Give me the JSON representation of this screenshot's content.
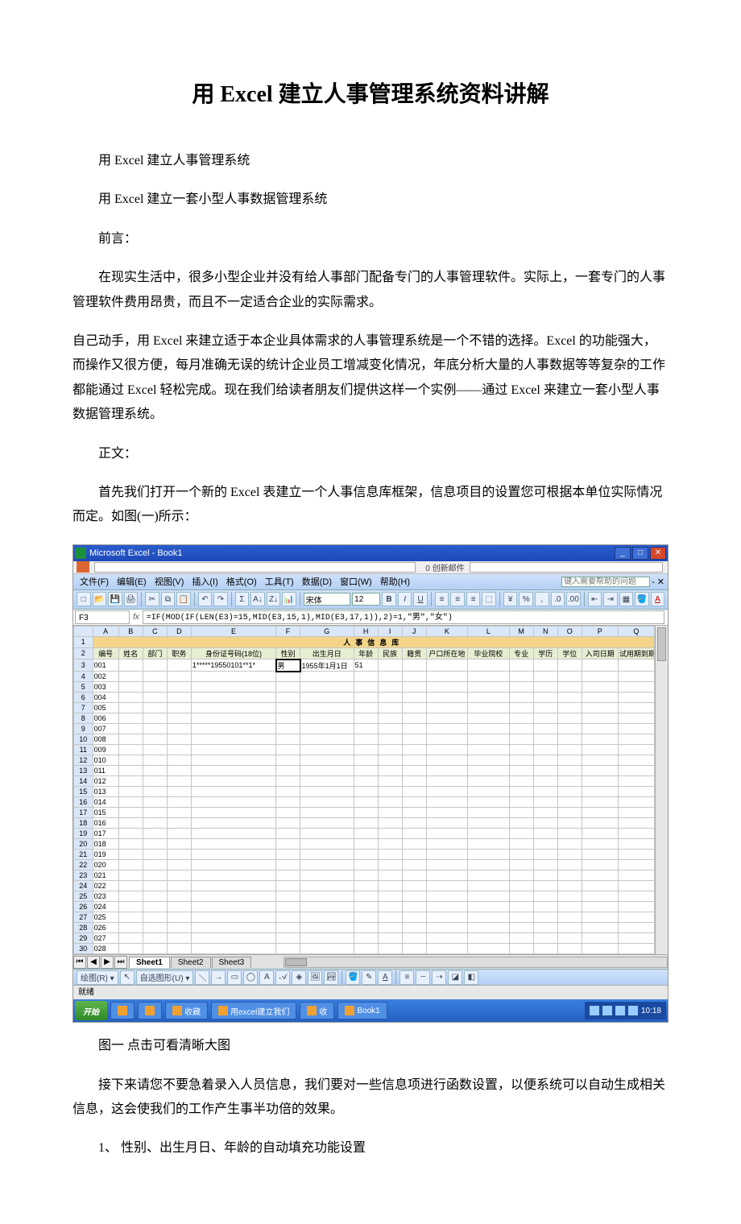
{
  "doc": {
    "title": "用 Excel 建立人事管理系统资料讲解",
    "p1": "用 Excel 建立人事管理系统",
    "p2": "用 Excel 建立一套小型人事数据管理系统",
    "p3": "前言：",
    "p4": "在现实生活中，很多小型企业并没有给人事部门配备专门的人事管理软件。实际上，一套专门的人事管理软件费用昂贵，而且不一定适合企业的实际需求。",
    "p5": "自己动手，用 Excel 来建立适于本企业具体需求的人事管理系统是一个不错的选择。Excel 的功能强大，而操作又很方便，每月准确无误的统计企业员工增减变化情况，年底分析大量的人事数据等等复杂的工作都能通过 Excel 轻松完成。现在我们给读者朋友们提供这样一个实例——通过 Excel 来建立一套小型人事数据管理系统。",
    "p6": "正文：",
    "p7": "首先我们打开一个新的 Excel 表建立一个人事信息库框架，信息项目的设置您可根据本单位实际情况而定。如图(一)所示：",
    "caption": "图一 点击可看清晰大图",
    "p8": "接下来请您不要急着录入人员信息，我们要对一些信息项进行函数设置，以便系统可以自动生成相关信息，这会使我们的工作产生事半功倍的效果。",
    "p9": "1、 性别、出生月日、年龄的自动填充功能设置"
  },
  "excel": {
    "app_title": "Microsoft Excel - Book1",
    "addr_text": "0 创新邮件",
    "menus": [
      "文件(F)",
      "编辑(E)",
      "视图(V)",
      "插入(I)",
      "格式(O)",
      "工具(T)",
      "数据(D)",
      "窗口(W)",
      "帮助(H)"
    ],
    "help_placeholder": "键入需要帮助的问题",
    "font_name": "宋体",
    "font_size": "12",
    "menu_close": "- ✕",
    "cell_ref": "F3",
    "fx_label": "fx",
    "formula": "=IF(MOD(IF(LEN(E3)=15,MID(E3,15,1),MID(E3,17,1)),2)=1,\"男\",\"女\")",
    "col_letters": [
      "A",
      "B",
      "C",
      "D",
      "E",
      "F",
      "G",
      "H",
      "I",
      "J",
      "K",
      "L",
      "M",
      "N",
      "O",
      "P",
      "Q"
    ],
    "sheet_title": "人事信息库",
    "headers": [
      "编号",
      "姓名",
      "部门",
      "职务",
      "身份证号码(18位)",
      "性别",
      "出生月日",
      "年龄",
      "民族",
      "籍贯",
      "户口所在地",
      "毕业院校",
      "专业",
      "学历",
      "学位",
      "入司日期",
      "试用期到期时间"
    ],
    "sample_row": {
      "id": "001",
      "idcard": "1*****19550101**1*",
      "sex": "男",
      "dob": "1955年1月1日",
      "age": "51"
    },
    "row_ids": [
      "001",
      "002",
      "003",
      "004",
      "005",
      "006",
      "007",
      "008",
      "009",
      "010",
      "011",
      "012",
      "013",
      "014",
      "015",
      "016",
      "017",
      "018",
      "019",
      "020",
      "021",
      "022",
      "023",
      "024",
      "025",
      "026",
      "027",
      "028"
    ],
    "sheet_tabs": [
      "Sheet1",
      "Sheet2",
      "Sheet3"
    ],
    "draw_label": "绘图(R) ▾",
    "autoshape_label": "自选图形(U) ▾",
    "status_text": "就绪"
  },
  "taskbar": {
    "start": "开始",
    "items": [
      "",
      "收藏",
      "用excel建立我们",
      "收",
      "Book1"
    ],
    "time": "10:18"
  }
}
